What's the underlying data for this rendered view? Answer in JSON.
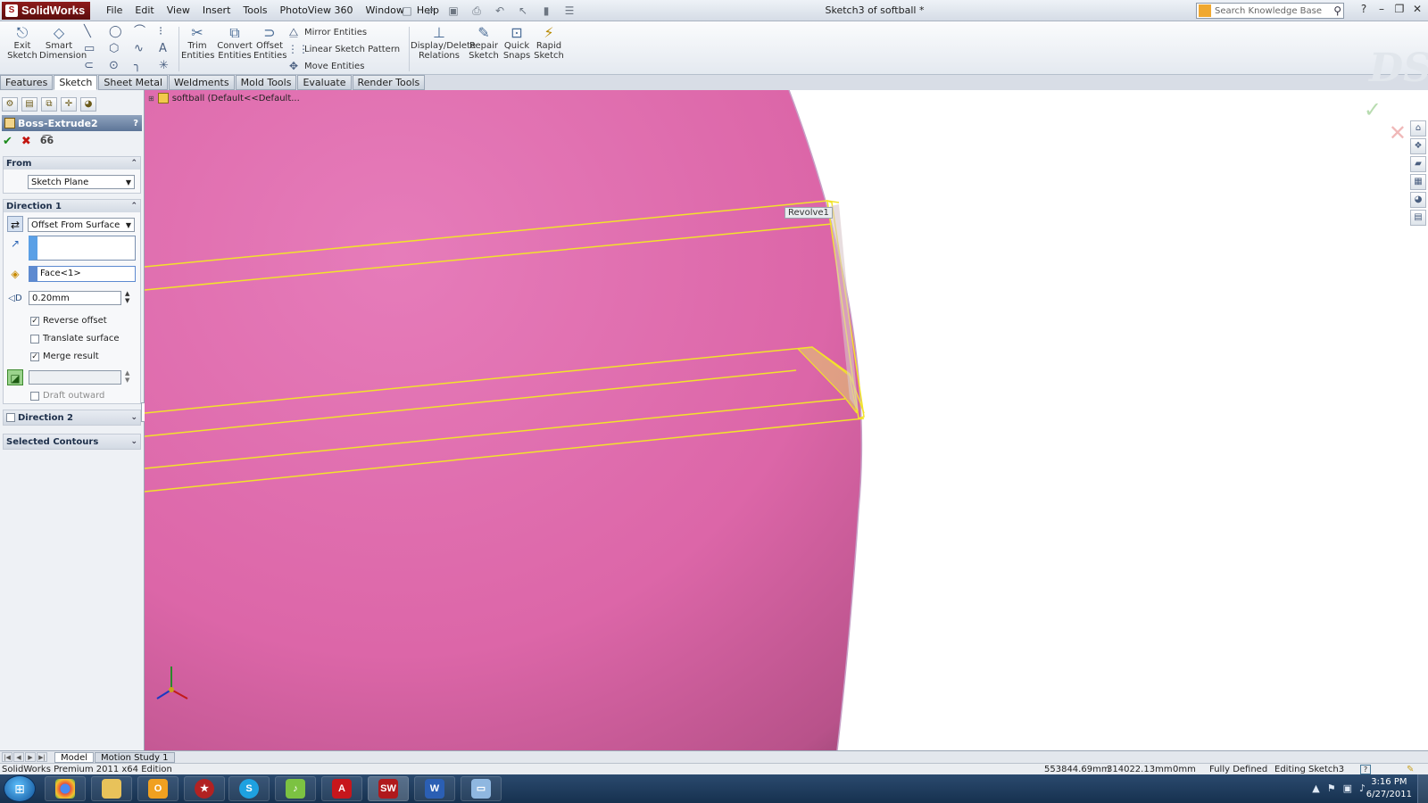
{
  "app": {
    "logo_text": "SolidWorks",
    "document_title": "Sketch3 of softball *",
    "menu": [
      "File",
      "Edit",
      "View",
      "Insert",
      "Tools",
      "PhotoView 360",
      "Window",
      "Help"
    ],
    "search_placeholder": "Search Knowledge Base"
  },
  "toolbar": {
    "exit_sketch": "Exit Sketch",
    "smart_dimension": "Smart Dimension",
    "trim_entities": "Trim Entities",
    "convert_entities": "Convert Entities",
    "offset_entities": "Offset Entities",
    "mirror_entities": "Mirror Entities",
    "linear_sketch_pattern": "Linear Sketch Pattern",
    "move_entities": "Move Entities",
    "display_delete_relations": "Display/Delete Relations",
    "repair_sketch": "Repair Sketch",
    "quick_snaps": "Quick Snaps",
    "rapid_sketch": "Rapid Sketch"
  },
  "tabs": [
    "Features",
    "Sketch",
    "Sheet Metal",
    "Weldments",
    "Mold Tools",
    "Evaluate",
    "Render Tools"
  ],
  "active_tab": "Sketch",
  "property_manager": {
    "title": "Boss-Extrude2",
    "from": {
      "header": "From",
      "value": "Sketch Plane"
    },
    "direction1": {
      "header": "Direction 1",
      "end_condition": "Offset From Surface",
      "direction_field": "",
      "face_field": "Face<1>",
      "offset_distance": "0.20mm",
      "reverse_offset_label": "Reverse offset",
      "reverse_offset": true,
      "translate_surface_label": "Translate surface",
      "translate_surface": false,
      "merge_result_label": "Merge result",
      "merge_result": true,
      "draft_outward_label": "Draft outward",
      "draft_outward": false
    },
    "direction2": {
      "header": "Direction 2"
    },
    "selected_contours": {
      "header": "Selected Contours"
    }
  },
  "viewport": {
    "tree_flyout": "softball  (Default<<Default...",
    "tooltip": "Revolve1",
    "face_color": "#e06aaa",
    "sketch_color": "#f2e32a"
  },
  "model_tabs": [
    "Model",
    "Motion Study 1"
  ],
  "status": {
    "edition": "SolidWorks Premium 2011 x64 Edition",
    "x": "553844.69mm",
    "y": "314022.13mm",
    "z": "0mm",
    "state": "Fully Defined",
    "mode": "Editing Sketch3"
  },
  "taskbar": {
    "time": "3:16 PM",
    "date": "6/27/2011"
  }
}
